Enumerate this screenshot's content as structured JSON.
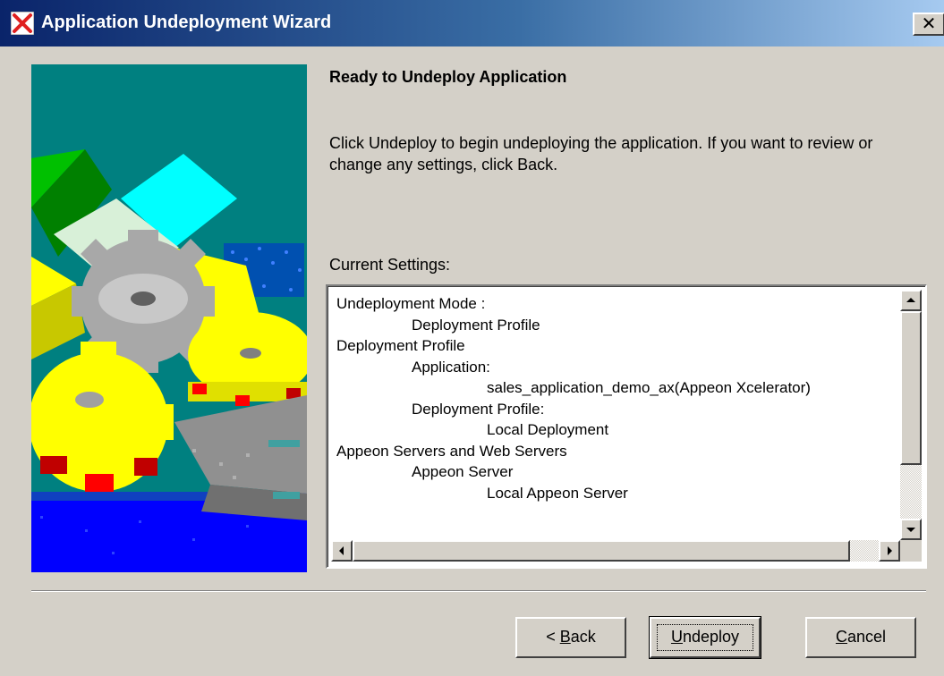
{
  "window": {
    "title": "Application Undeployment Wizard",
    "close_glyph": "✕"
  },
  "page": {
    "heading": "Ready to Undeploy Application",
    "description": "Click Undeploy to begin undeploying the application. If you want to review or change any settings, click Back.",
    "settings_label": "Current Settings:"
  },
  "settings": {
    "lines": [
      {
        "text": "Undeployment Mode :",
        "level": 0
      },
      {
        "text": "Deployment Profile",
        "level": 1
      },
      {
        "text": "Deployment Profile",
        "level": 0
      },
      {
        "text": "Application:",
        "level": 1
      },
      {
        "text": "sales_application_demo_ax(Appeon Xcelerator)",
        "level": 2
      },
      {
        "text": "Deployment Profile:",
        "level": 1
      },
      {
        "text": "Local Deployment",
        "level": 2
      },
      {
        "text": "Appeon Servers and Web Servers",
        "level": 0
      },
      {
        "text": "Appeon Server",
        "level": 1
      },
      {
        "text": "Local Appeon Server",
        "level": 2
      }
    ]
  },
  "buttons": {
    "back_prefix": "< ",
    "back_mnemonic": "B",
    "back_rest": "ack",
    "undeploy_mnemonic": "U",
    "undeploy_rest": "ndeploy",
    "cancel_mnemonic": "C",
    "cancel_rest": "ancel"
  },
  "colors": {
    "titlebar_start": "#0a246a",
    "titlebar_end": "#a6caf0",
    "dialog_bg": "#d4d0c8",
    "illustration_teal": "#008080",
    "illustration_yellow": "#ffff00",
    "illustration_blue": "#0000ff"
  },
  "icons": {
    "app": "red-x-icon",
    "close": "close-icon",
    "scroll_up": "scroll-up-arrow-icon",
    "scroll_down": "scroll-down-arrow-icon",
    "scroll_left": "scroll-left-arrow-icon",
    "scroll_right": "scroll-right-arrow-icon"
  }
}
